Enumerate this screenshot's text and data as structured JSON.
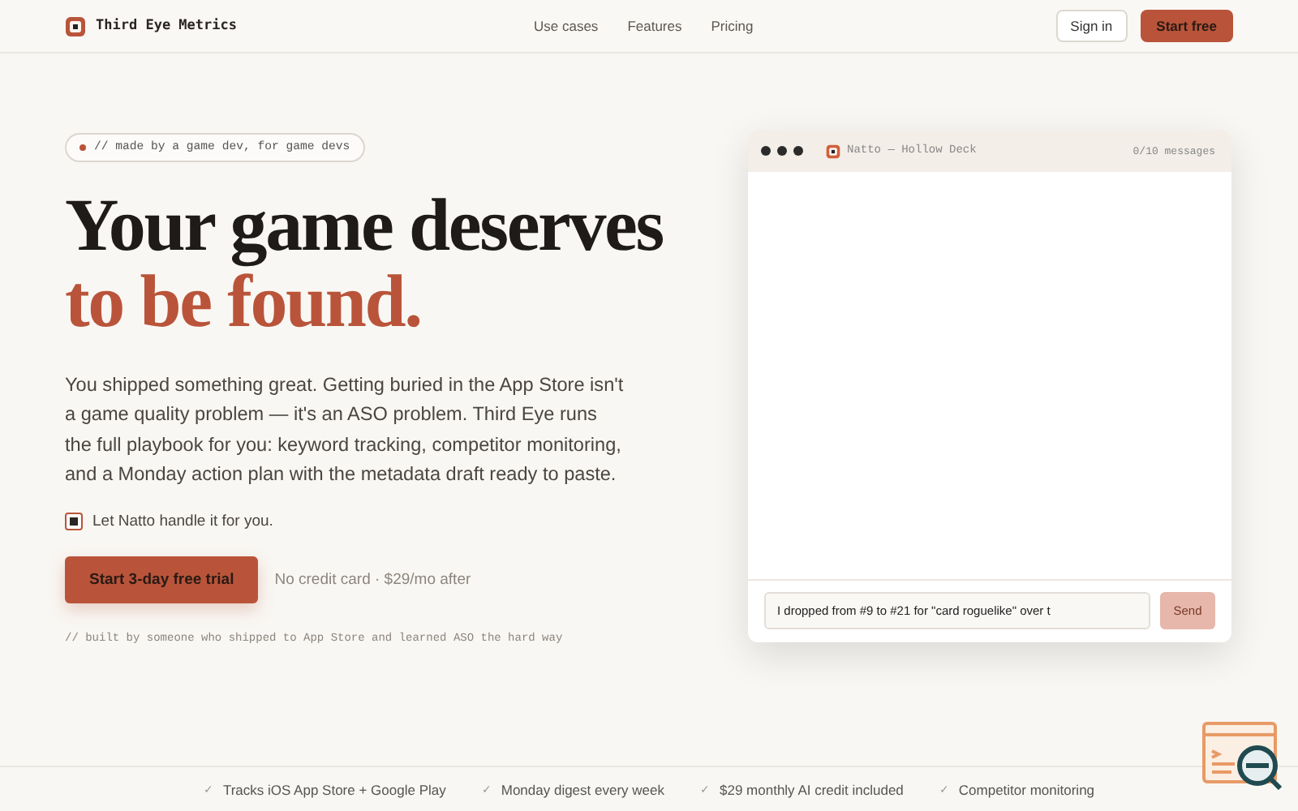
{
  "nav": {
    "brand": "Third Eye Metrics",
    "links": [
      "Use cases",
      "Features",
      "Pricing"
    ],
    "sign_in": "Sign in",
    "start": "Start free"
  },
  "hero": {
    "tag": "// made by a game dev, for game devs",
    "headline": "Your game deserves",
    "headline_accent": "to be found.",
    "body": "You shipped something great. Getting buried in the App Store isn't a game quality problem — it's an ASO problem. Third Eye runs the full playbook for you: keyword tracking, competitor monitoring, and a Monday action plan with the metadata draft ready to paste.",
    "option": {
      "label": "Let Natto handle it for you.",
      "checked": true
    },
    "cta": "Start 3-day free trial",
    "cta_note": "No credit card · $29/mo after",
    "footnote": "// built by someone who shipped to App Store and learned ASO the hard way"
  },
  "chat": {
    "title": "Natto — Hollow Deck",
    "count": "0/10 messages",
    "input_value": "I dropped from #9 to #21 for \"card roguelike\" over t",
    "send": {
      "label": "Send",
      "disabled": true
    }
  },
  "features": [
    {
      "check": "✓",
      "text": "Tracks iOS App Store + Google Play"
    },
    {
      "check": "✓",
      "text": "Monday digest every week"
    },
    {
      "check": "✓",
      "text": "$29 monthly AI credit included"
    },
    {
      "check": "✓",
      "text": "Competitor monitoring"
    }
  ]
}
